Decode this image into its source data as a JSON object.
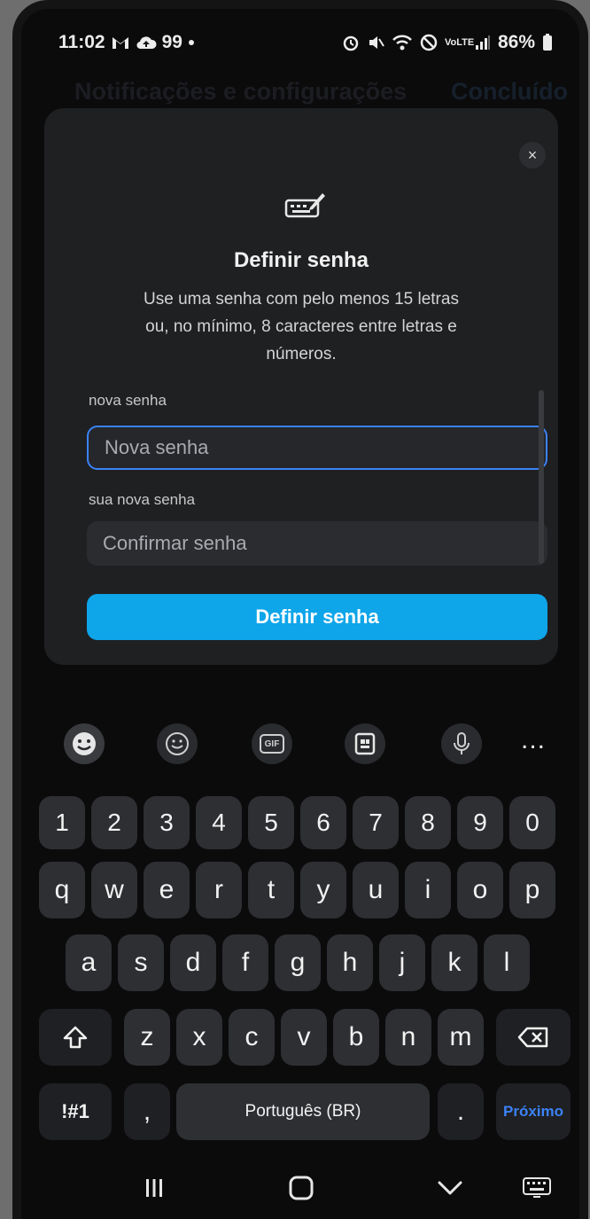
{
  "status_bar": {
    "time": "11:02",
    "notification_count": "99",
    "battery": "86%",
    "icons": [
      "gmail-icon",
      "cloud-upload-icon",
      "notification-dot-icon",
      "alarm-icon",
      "mute-icon",
      "wifi-icon",
      "dnd-icon",
      "volte-icon",
      "signal-icon",
      "battery-icon"
    ],
    "volte_label": "VoLTE"
  },
  "background": {
    "title": "Notificações e configurações",
    "action": "Concluído"
  },
  "modal": {
    "icon": "password-keyboard-icon",
    "title": "Definir senha",
    "description": "Use uma senha com pelo menos 15 letras ou, no mínimo, 8 caracteres entre letras e números.",
    "new_password_label": "nova senha",
    "new_password_placeholder": "Nova senha",
    "confirm_label": "sua nova senha",
    "confirm_placeholder": "Confirmar senha",
    "submit_label": "Definir senha",
    "close_label": "×"
  },
  "keyboard_toolbar": {
    "items": [
      "emoji-icon",
      "sticker-icon",
      "gif-icon",
      "clipboard-icon",
      "microphone-icon",
      "more-icon"
    ],
    "more_label": "...",
    "gif_label": "GIF"
  },
  "keyboard": {
    "numbers": [
      "1",
      "2",
      "3",
      "4",
      "5",
      "6",
      "7",
      "8",
      "9",
      "0"
    ],
    "row1": [
      "q",
      "w",
      "e",
      "r",
      "t",
      "y",
      "u",
      "i",
      "o",
      "p"
    ],
    "row2": [
      "a",
      "s",
      "d",
      "f",
      "g",
      "h",
      "j",
      "k",
      "l"
    ],
    "row3": [
      "z",
      "x",
      "c",
      "v",
      "b",
      "n",
      "m"
    ],
    "symbols_label": "!#1",
    "comma": ",",
    "space_label": "Português (BR)",
    "period": ".",
    "next_label": "Próximo"
  },
  "nav_bar": {
    "items": [
      "recents-icon",
      "home-icon",
      "back-icon",
      "keyboard-switch-icon"
    ]
  },
  "colors": {
    "accent": "#0ea5e9",
    "focus_border": "#3b82f6",
    "modal_bg": "#1f2022",
    "key_bg": "#2e2f33"
  }
}
